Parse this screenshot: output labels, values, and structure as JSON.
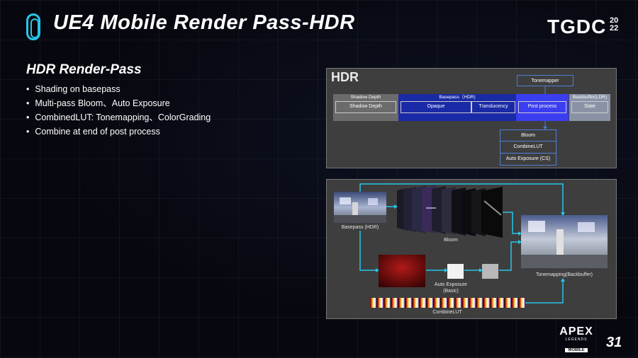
{
  "header": {
    "title": "UE4 Mobile Render Pass-HDR",
    "logo_text": "TGDC",
    "logo_year_top": "20",
    "logo_year_bottom": "22"
  },
  "section": {
    "title": "HDR Render-Pass",
    "bullets": [
      "Shading on basepass",
      "Multi-pass Bloom、Auto Exposure",
      "CombinedLUT: Tonemapping、ColorGrading",
      "Combine at end of post process"
    ]
  },
  "hdr_diagram": {
    "label": "HDR",
    "shadow_depth_head": "Shadow Depth",
    "shadow_depth_inner": "Shadow Depth",
    "basepass_head": "Basepass（HDR)",
    "opaque": "Opaque",
    "translucency": "Translucency",
    "post_process": "Post process",
    "backbuffer_head": "Backbuffer(LDR)",
    "slate": "Slate",
    "tonemapper": "Tonemapper",
    "bloom": "Bloom",
    "combinelut": "CombineLUT",
    "auto_exposure": "Auto Exposure (CS)"
  },
  "flow_diagram": {
    "basepass_caption": "Basepass (HDR)",
    "bloom_caption": "Bloom",
    "auto_exposure_caption_1": "Auto Exposure",
    "auto_exposure_caption_2": "(Basic)",
    "tonemapping_caption": "Tonemapping(Backbuffer)",
    "combinelut_caption": "CombineLUT"
  },
  "footer": {
    "apex_title": "APEX",
    "apex_sub": "LEGENDS",
    "apex_mobile": "MOBILE",
    "page_number": "31"
  },
  "colors": {
    "accent": "#27c6e8",
    "basepass_blue": "#1a2aa6",
    "postprocess_blue": "#3b3df0",
    "backbuffer_grey": "#8a93a6"
  }
}
